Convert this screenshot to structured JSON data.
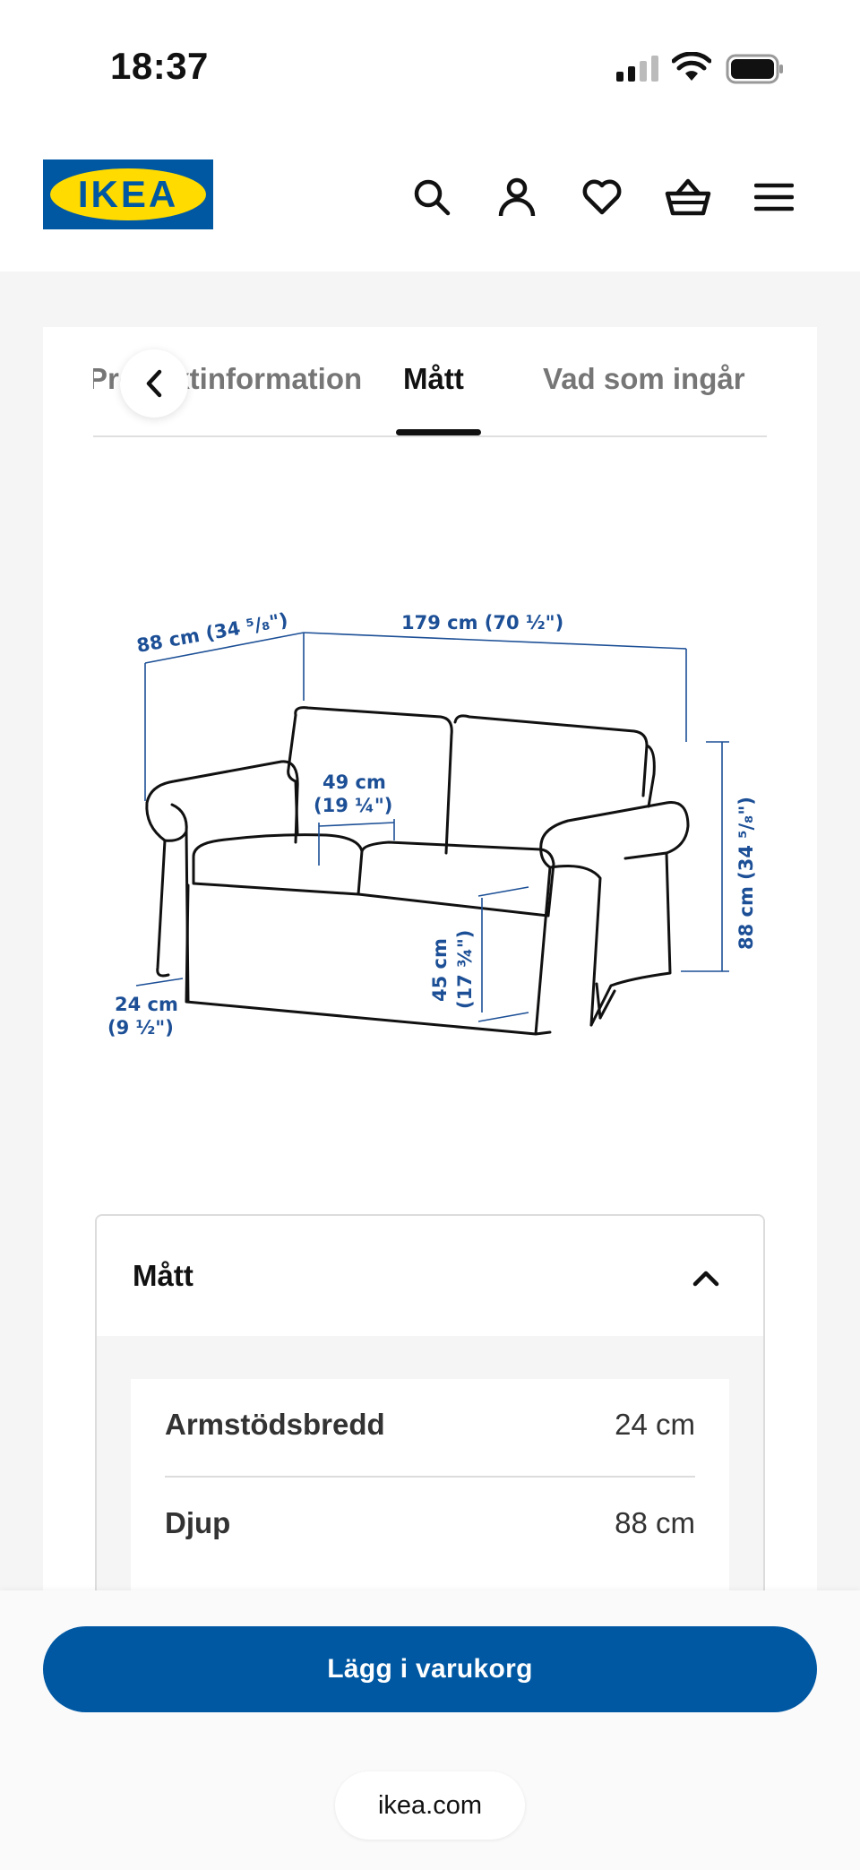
{
  "status_bar": {
    "time": "18:37",
    "icons": [
      "signal-icon",
      "wifi-icon",
      "battery-icon"
    ]
  },
  "header": {
    "logo_text": "IKEA",
    "icons": [
      "search-icon",
      "account-icon",
      "wishlist-icon",
      "cart-icon",
      "menu-icon"
    ]
  },
  "tabs": {
    "items": [
      {
        "label": "Produktinformation"
      },
      {
        "label": "Mått"
      },
      {
        "label": "Vad som ingår"
      }
    ],
    "active": "Mått"
  },
  "illustration": {
    "depth_label": "88 cm (34 ⁵/₈\")",
    "width_label": "179 cm (70 ½\")",
    "height_label": "88 cm (34 ⁵/₈\")",
    "seat_width_line1": "49 cm",
    "seat_width_line2": "(19 ¼\")",
    "seat_height_line1": "45 cm",
    "seat_height_line2": "(17 ¾\")",
    "armrest_line1": "24 cm",
    "armrest_line2": "(9 ½\")"
  },
  "accordion": {
    "title": "Mått",
    "rows": [
      {
        "label": "Armstödsbredd",
        "value": "24 cm"
      },
      {
        "label": "Djup",
        "value": "88 cm"
      }
    ]
  },
  "cta": {
    "label": "Lägg i varukorg"
  },
  "browser": {
    "url": "ikea.com"
  },
  "colors": {
    "brand_blue": "#0058a3",
    "brand_yellow": "#ffdb00",
    "dimension_blue": "#1c4f96"
  }
}
